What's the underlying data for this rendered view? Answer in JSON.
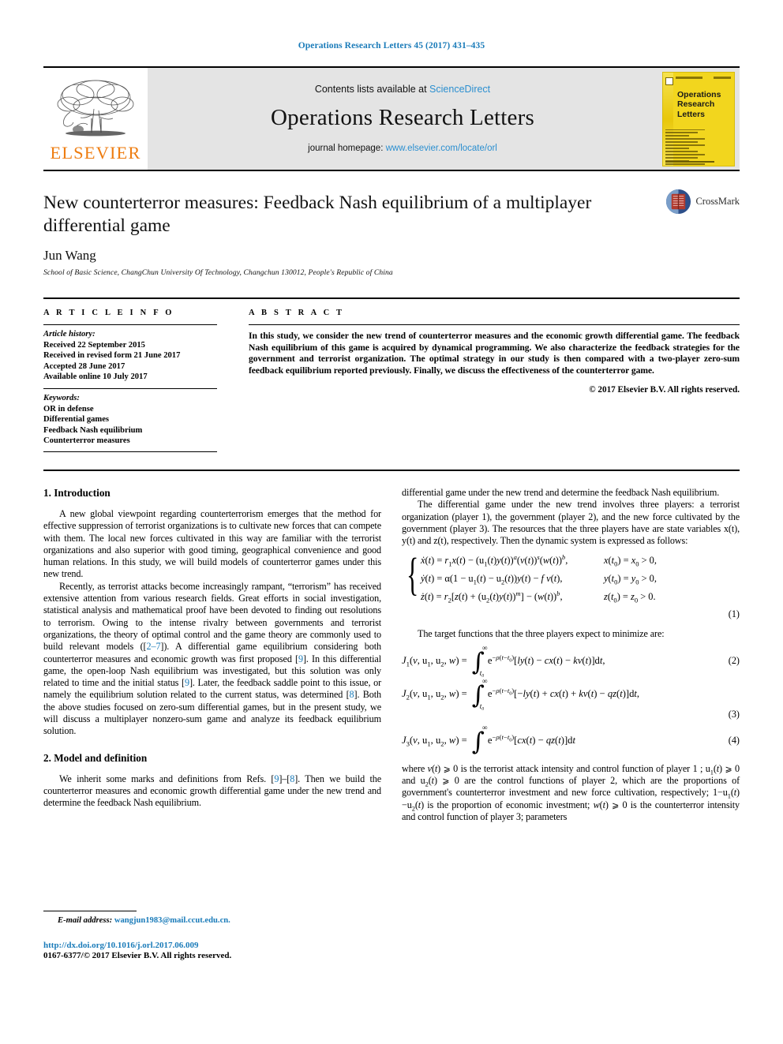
{
  "running_head": "Operations Research Letters 45 (2017) 431–435",
  "masthead": {
    "publisher_name": "ELSEVIER",
    "contents_prefix": "Contents lists available at ",
    "contents_link": "ScienceDirect",
    "journal_name": "Operations Research Letters",
    "homepage_prefix": "journal homepage: ",
    "homepage_link": "www.elsevier.com/locate/orl",
    "cover_title_line1": "Operations",
    "cover_title_line2": "Research",
    "cover_title_line3": "Letters"
  },
  "article": {
    "title": "New counterterror measures: Feedback Nash equilibrium of a multiplayer differential game",
    "author": "Jun Wang",
    "affiliation": "School of Basic Science, ChangChun University Of Technology, Changchun 130012, People's Republic of China",
    "crossmark_label": "CrossMark"
  },
  "info": {
    "heading": "A R T I C L E   I N F O",
    "history_label": "Article history:",
    "history": [
      "Received 22 September 2015",
      "Received in revised form 21 June 2017",
      "Accepted 28 June 2017",
      "Available online 10 July 2017"
    ],
    "keywords_label": "Keywords:",
    "keywords": [
      "OR in defense",
      "Differential games",
      "Feedback Nash equilibrium",
      "Counterterror measures"
    ]
  },
  "abstract": {
    "heading": "A B S T R A C T",
    "text": "In this study, we consider the new trend of counterterror measures and the economic growth differential game. The feedback Nash equilibrium of this game is acquired by dynamical programming. We also characterize the feedback strategies for the government and terrorist organization. The optimal strategy in our study is then compared with a two-player zero-sum feedback equilibrium reported previously. Finally, we discuss the effectiveness of the counterterror game.",
    "copyright": "© 2017 Elsevier B.V. All rights reserved."
  },
  "sections": {
    "introduction_heading": "1. Introduction",
    "intro_p1_a": "A new global viewpoint regarding counterterrorism emerges that the method for effective suppression of terrorist organizations is to cultivate new forces that can compete with them. The local new forces cultivated in this way are familiar with the terrorist organizations and also superior with good timing, geographical convenience and good human relations. In this study, we will build models of counterterror games under this new trend.",
    "intro_p2_a": "Recently, as terrorist attacks become increasingly rampant, “terrorism” has received extensive attention from various research fields. Great efforts in social investigation, statistical analysis and mathematical proof have been devoted to finding out resolutions to terrorism. Owing to the intense rivalry between governments and terrorist organizations, the theory of optimal control and the game theory are commonly used to build relevant models ([",
    "intro_p2_ref1": "2–7",
    "intro_p2_b": "]). A differential game equilibrium considering both counterterror measures and economic growth was first proposed [",
    "intro_p2_ref2": "9",
    "intro_p2_c": "]. In this differential game, the open-loop Nash equilibrium was investigated, but this solution was only related to time and the initial status [",
    "intro_p2_ref3": "9",
    "intro_p2_d": "]. Later, the feedback saddle point to this issue, or namely the equilibrium solution related to the current status, was determined  [",
    "intro_p2_ref4": "8",
    "intro_p2_e": "]. Both the above studies focused on zero-sum differential games, but in the present study, we will discuss a multiplayer nonzero-sum game and analyze its feedback equilibrium solution.",
    "model_heading": "2. Model and definition",
    "model_p1_a": "We inherit some marks and definitions from Refs. [",
    "model_p1_ref1": "9",
    "model_p1_b": "]–[",
    "model_p1_ref2": "8",
    "model_p1_c": "]. Then we build the counterterror measures and economic growth differential game under the new trend and determine the feedback Nash equilibrium.",
    "right_p1": "The differential game under the new trend involves three players: a terrorist organization (player 1), the government (player 2), and the new force cultivated by the government (player 3). The resources that the three players have are state variables x(t), y(t) and z(t), respectively. Then the dynamic system is expressed as follows:",
    "right_p2": "The target functions that the three players expect to minimize are:",
    "where_p_a": "where v(t) ⩾ 0 is the terrorist attack intensity and control function of player 1 ; u",
    "where_p_full": "where v(t) ⩾ 0 is the terrorist attack intensity and control function of player 1 ; u1(t) ⩾ 0 and u2(t) ⩾ 0 are the control functions of player 2, which are the proportions of government's counterterror investment and new force cultivation, respectively; 1−u1(t)−u2(t) is the proportion of economic investment; w(t) ⩾ 0 is the counterterror intensity and control function of player 3; parameters"
  },
  "equations": {
    "eq1_row1_lhs": "ẋ(t) = r₁x(t) − (u₁(t)y(t))ᵃ(v(t))ˢ(w(t))ᵇ,",
    "eq1_row1_rhs": "x(t₀) = x₀ > 0,",
    "eq1_row2_lhs": "ẏ(t) = α(1 − u₁(t) − u₂(t))y(t) − f v(t),",
    "eq1_row2_rhs": "y(t₀) = y₀ > 0,",
    "eq1_row3_lhs": "ż(t) = r₂[z(t) + (u₂(t)y(t))ᵐ] − (w(t))ᵇ,",
    "eq1_row3_rhs": "z(t₀) = z₀ > 0.",
    "eq1_number": "(1)",
    "eq2_lhs": "J₁(v, u₁, u₂, w) =",
    "eq2_integrand": "e^{−ρ(t−t₀)}[ly(t) − cx(t) − kv(t)]dt,",
    "eq2_number": "(2)",
    "eq3_lhs": "J₂(v, u₁, u₂, w) =",
    "eq3_integrand": "e^{−ρ(t−t₀)}[−ly(t) + cx(t) + kv(t) − qz(t)]dt,",
    "eq3_number": "(3)",
    "eq4_lhs": "J₃(v, u₁, u₂, w) =",
    "eq4_integrand": "e^{−ρ(t−t₀)}[cx(t) − qz(t)]dt",
    "eq4_number": "(4)",
    "int_upper": "∞",
    "int_lower": "t₀"
  },
  "footnote": {
    "email_label": "E-mail address:",
    "email": "wangjun1983@mail.ccut.edu.cn.",
    "doi": "http://dx.doi.org/10.1016/j.orl.2017.06.009",
    "issn": "0167-6377/© 2017 Elsevier B.V. All rights reserved."
  },
  "colors": {
    "link_blue": "#1a7bb9",
    "elsevier_orange": "#ee7d11",
    "cover_yellow": "#f2d61e",
    "masthead_gray": "#e4e4e4"
  }
}
